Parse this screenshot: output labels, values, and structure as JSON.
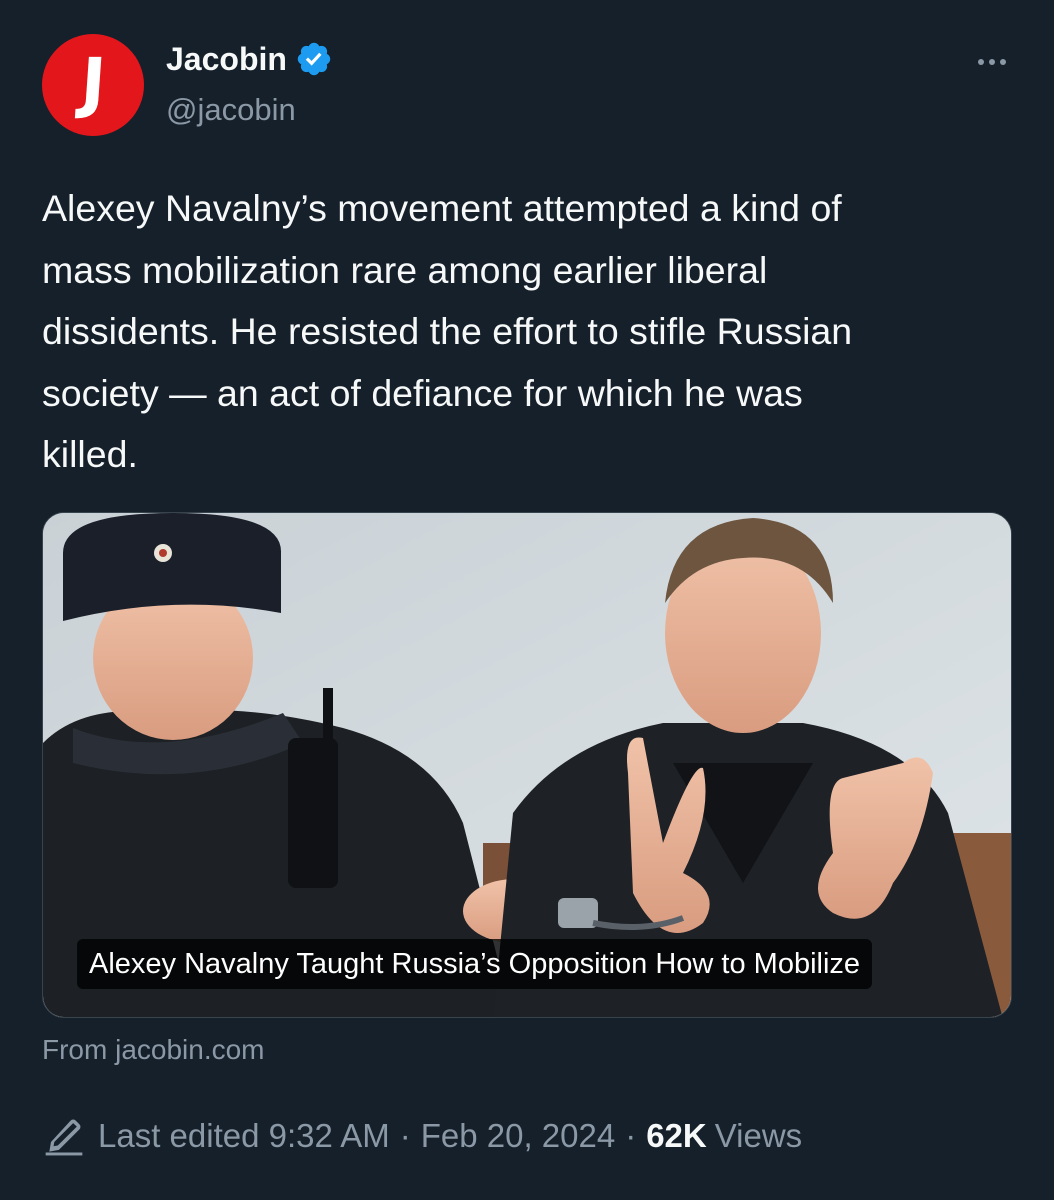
{
  "account": {
    "display_name": "Jacobin",
    "handle": "@jacobin",
    "avatar_letter": "J",
    "avatar_color": "#e3171b",
    "verified_color": "#1d9bf0"
  },
  "tweet": {
    "text": "Alexey Navalny’s movement attempted a kind of\nmass mobilization rare among earlier liberal\ndissidents. He resisted the effort to stifle Russian\nsociety — an act of defiance for which he was\nkilled."
  },
  "card": {
    "title": "Alexey Navalny Taught Russia’s Opposition How to Mobilize",
    "source": "From jacobin.com"
  },
  "meta": {
    "edited_label": "Last edited 9:32 AM",
    "separator": "·",
    "date": "Feb 20, 2024",
    "views_count": "62K",
    "views_label": "Views"
  },
  "icons": {
    "more": "more-horizontal-icon",
    "verified": "verified-badge-icon",
    "edit": "edit-pencil-icon"
  },
  "colors": {
    "background": "#15202b",
    "text_primary": "#f7f9f9",
    "text_secondary": "#8b98a5"
  }
}
